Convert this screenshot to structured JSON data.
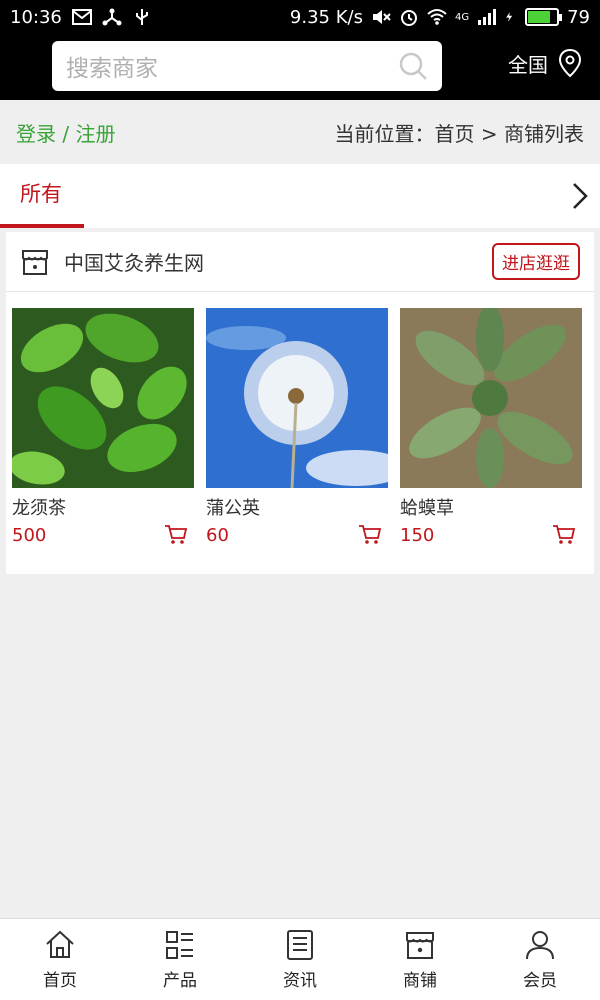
{
  "status_bar": {
    "time": "10:36",
    "net_speed": "9.35 K/s",
    "network": "4G",
    "battery": "79",
    "battery_level": 0.79
  },
  "header": {
    "search_placeholder": "搜索商家",
    "region": "全国"
  },
  "breadcrumb": {
    "login": "登录 / 注册",
    "location": "当前位置：首页 > 商铺列表"
  },
  "tabs": {
    "active": "所有"
  },
  "shop": {
    "name": "中国艾灸养生网",
    "enter_label": "进店逛逛",
    "products": [
      {
        "name": "龙须茶",
        "price": "500",
        "image": "green-leaves-photo"
      },
      {
        "name": "蒲公英",
        "price": "60",
        "image": "dandelion-photo"
      },
      {
        "name": "蛤蟆草",
        "price": "150",
        "image": "plantain-herb-photo"
      }
    ]
  },
  "nav": {
    "items": [
      {
        "label": "首页",
        "icon": "home-icon"
      },
      {
        "label": "产品",
        "icon": "product-grid-icon"
      },
      {
        "label": "资讯",
        "icon": "news-icon"
      },
      {
        "label": "商铺",
        "icon": "shop-icon"
      },
      {
        "label": "会员",
        "icon": "member-icon"
      }
    ]
  },
  "colors": {
    "accent": "#c0161c",
    "login": "#3aa33a",
    "header_bg": "#000000"
  }
}
